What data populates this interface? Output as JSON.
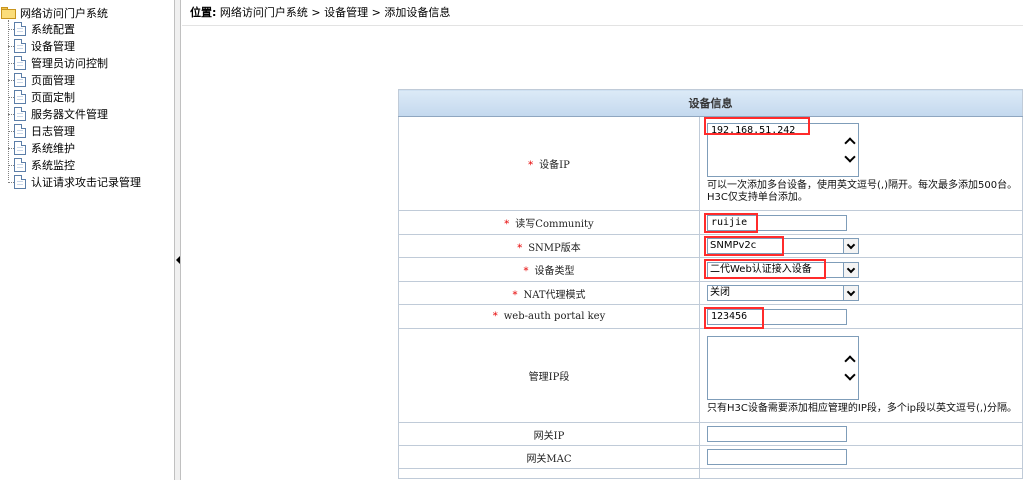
{
  "sidebar": {
    "root": {
      "label": "网络访问门户系统",
      "icon": "folder-open-icon"
    },
    "items": [
      {
        "label": "系统配置",
        "icon": "document-icon"
      },
      {
        "label": "设备管理",
        "icon": "document-icon"
      },
      {
        "label": "管理员访问控制",
        "icon": "document-icon"
      },
      {
        "label": "页面管理",
        "icon": "document-icon"
      },
      {
        "label": "页面定制",
        "icon": "document-icon"
      },
      {
        "label": "服务器文件管理",
        "icon": "document-icon"
      },
      {
        "label": "日志管理",
        "icon": "document-icon"
      },
      {
        "label": "系统维护",
        "icon": "document-icon"
      },
      {
        "label": "系统监控",
        "icon": "document-icon"
      },
      {
        "label": "认证请求攻击记录管理",
        "icon": "document-icon"
      }
    ]
  },
  "breadcrumb": {
    "prefix": "位置:",
    "path": "网络访问门户系统 > 设备管理 > 添加设备信息"
  },
  "form": {
    "title": "设备信息",
    "required_mark": "*",
    "fields": {
      "device_ip": {
        "label": "设备IP",
        "value": "192.168.51.242",
        "hint": "可以一次添加多台设备，使用英文逗号(,)隔开。每次最多添加500台。H3C仅支持单台添加。"
      },
      "community": {
        "label": "读写Community",
        "value": "ruijie"
      },
      "snmp_version": {
        "label": "SNMP版本",
        "value": "SNMPv2c"
      },
      "device_type": {
        "label": "设备类型",
        "value": "二代Web认证接入设备"
      },
      "nat_mode": {
        "label": "NAT代理模式",
        "value": "关闭"
      },
      "portal_key": {
        "label": "web-auth portal key",
        "value": "123456"
      },
      "mgmt_ip_range": {
        "label": "管理IP段",
        "value": "",
        "hint": "只有H3C设备需要添加相应管理的IP段，多个ip段以英文逗号(,)分隔。"
      },
      "gateway_ip": {
        "label": "网关IP",
        "value": ""
      },
      "gateway_mac": {
        "label": "网关MAC",
        "value": ""
      }
    }
  },
  "colors": {
    "required": "#e60000",
    "highlight_box": "#ff2b2b",
    "header_bg": "#c3d8ee"
  }
}
